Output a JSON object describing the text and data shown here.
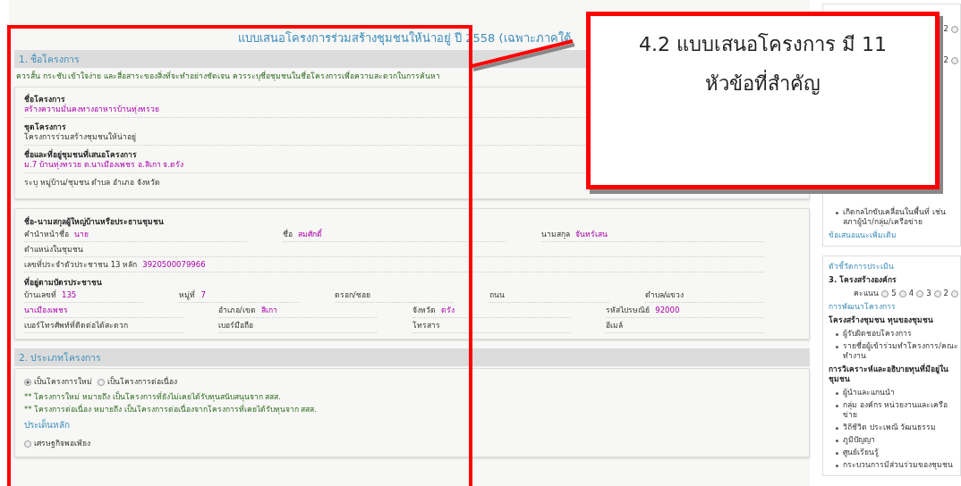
{
  "title": "แบบเสนอโครงการร่วมสร้างชุมชนให้น่าอยู่ ปี 2558 (เฉพาะภาคใต้",
  "sections": [
    {
      "header": "1. ชื่อโครงการ",
      "hint": "ควรสั้น กระชับ เข้าใจง่าย และสื่อสาระของสิ่งที่จะทำอย่างชัดเจน ควรระบุชื่อชุมชนในชื่อโครงการเพื่อความสะดวกในการค้นหา",
      "panels": [
        {
          "blocks": [
            {
              "kind": "stacked",
              "label": "ชื่อโครงการ",
              "value": "สร้างความมั่นคงทางอาหารบ้านทุ่งทรวย",
              "editable": true
            },
            {
              "kind": "stacked",
              "label": "ชุดโครงการ",
              "value": "โครงการร่วมสร้างชุมชนให้น่าอยู่",
              "editable": false
            },
            {
              "kind": "stacked",
              "label": "ชื่อและที่อยู่ชุมชนที่เสนอโครงการ",
              "value": "ม.7 บ้านทุ่งทรวย ต.นาเมืองเพชร อ.สิเกา จ.ตรัง",
              "editable": true
            },
            {
              "kind": "note",
              "text": "ระบุ หมู่บ้าน/ชุมชน ตำบล อำเภอ จังหวัด"
            }
          ]
        },
        {
          "blocks": [
            {
              "kind": "heading",
              "text": "ชื่อ-นามสกุลผู้ใหญ่บ้านหรือประธานชุมชน"
            },
            {
              "kind": "row",
              "fields": [
                {
                  "label": "คำนำหน้าชื่อ",
                  "value": "นาย"
                },
                {
                  "label": "ชื่อ",
                  "value": "สมศักดิ์"
                },
                {
                  "label": "นามสกุล",
                  "value": "จันทร์เสน"
                }
              ]
            },
            {
              "kind": "row",
              "fields": [
                {
                  "label": "ตำแหน่งในชุมชน"
                }
              ]
            },
            {
              "kind": "row",
              "fields": [
                {
                  "label": "เลขที่ประจำตัวประชาชน 13 หลัก",
                  "value": "3920500079966"
                }
              ]
            },
            {
              "kind": "heading",
              "text": "ที่อยู่ตามบัตรประชาชน"
            },
            {
              "kind": "row",
              "fields": [
                {
                  "label": "บ้านเลขที่",
                  "value": "135"
                },
                {
                  "label": "หมู่ที่",
                  "value": "7"
                },
                {
                  "label": "ตรอก/ซอย"
                },
                {
                  "label": "ถนน"
                },
                {
                  "label": "ตำบล/แขวง"
                }
              ]
            },
            {
              "kind": "row",
              "fields": [
                {
                  "value": "นาเมืองเพชร"
                },
                {
                  "label": "อำเภอ/เขต",
                  "value": "สิเกา"
                },
                {
                  "label": "จังหวัด",
                  "value": "ตรัง"
                },
                {
                  "label": "รหัสไปรษณีย์",
                  "value": "92000"
                }
              ]
            },
            {
              "kind": "row",
              "fields": [
                {
                  "label": "เบอร์โทรศัพท์ที่ติดต่อได้สะดวก"
                },
                {
                  "label": "เบอร์มือถือ"
                },
                {
                  "label": "โทรสาร"
                },
                {
                  "label": "อีเมล์"
                }
              ]
            }
          ]
        }
      ]
    },
    {
      "header": "2. ประเภทโครงการ",
      "panels": [
        {
          "blocks": [
            {
              "kind": "radios",
              "options": [
                {
                  "label": "เป็นโครงการใหม่",
                  "selected": true
                },
                {
                  "label": "เป็นโครงการต่อเนื่อง",
                  "selected": false
                }
              ]
            },
            {
              "kind": "green_note",
              "text": "** โครงการใหม่ หมายถึง เป็นโครงการที่ยังไม่เคยได้รับทุนสนับสนุนจาก สสส."
            },
            {
              "kind": "green_note",
              "text": "** โครงการต่อเนื่อง หมายถึง เป็นโครงการต่อเนื่องจากโครงการที่เคยได้รับทุนจาก สสส."
            },
            {
              "kind": "subheading",
              "text": "ประเด็นหลัก"
            },
            {
              "kind": "radios",
              "options": [
                {
                  "label": "เศรษฐกิจพอเพียง",
                  "selected": false
                }
              ]
            }
          ]
        }
      ]
    }
  ],
  "sidebar": {
    "top_scores": [
      {
        "label": "2",
        "selected": false
      },
      {
        "label": "2",
        "selected": false
      }
    ],
    "top_bullets": [
      "เกิดกลไกขับเคลื่อนในพื้นที่ เช่น สภาผู้นำ/กลุ่ม/เครือข่าย"
    ],
    "top_link": "ข้อเสนอแนะเพิ่มเติม",
    "panel": {
      "title": "ตัวชี้วัดการประเมิน",
      "criterion": "3. โครงสร้างองค์กร",
      "score_label": "คะแนน",
      "score_options": [
        {
          "label": "5",
          "selected": false
        },
        {
          "label": "4",
          "selected": false
        },
        {
          "label": "3",
          "selected": false
        },
        {
          "label": "2",
          "selected": false
        },
        {
          "selected": false
        }
      ],
      "subtitle": "การพัฒนาโครงการ",
      "groups": [
        {
          "heading": "โครงสร้างชุมชน ทุนของชุมชน",
          "items": [
            "ผู้รับผิดชอบโครงการ",
            "รายชื่อผู้เข้าร่วมทำโครงการ/คณะทำงาน"
          ]
        },
        {
          "heading": "การวิเคราะห์และอธิบายทุนที่มีอยู่ในชุมชน",
          "items": [
            "ผู้นำและแกนนำ",
            "กลุ่ม องค์กร หน่วยงานและเครือข่าย",
            "วิถีชีวิต ประเพณี วัฒนธรรม",
            "ภูมิปัญญา",
            "ศูนย์เรียนรู้",
            "กระบวนการมีส่วนร่วมของชุมชน"
          ]
        }
      ]
    }
  },
  "annotation": {
    "lines": [
      "4.2 แบบเสนอโครงการ มี 11",
      "หัวข้อที่สำคัญ"
    ]
  }
}
